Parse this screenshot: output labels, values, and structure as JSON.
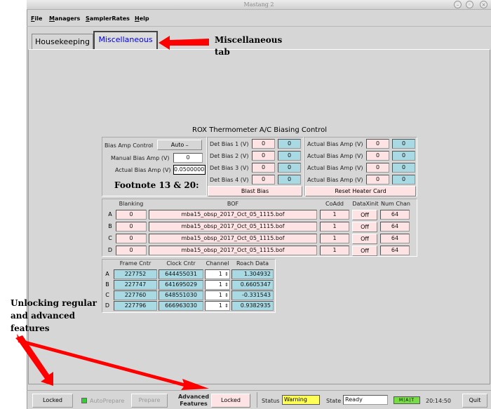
{
  "window": {
    "title": "Mastang 2"
  },
  "menu": {
    "items": [
      {
        "first": "F",
        "rest": "ile"
      },
      {
        "first": "M",
        "rest": "anagers"
      },
      {
        "first": "S",
        "rest": "amplerRates"
      },
      {
        "first": "H",
        "rest": "elp"
      }
    ]
  },
  "tabs": {
    "housekeeping": "Housekeeping",
    "miscellaneous": "Miscellaneous"
  },
  "annotations": {
    "misc_tab_line1": "Miscellaneous",
    "misc_tab_line2": "tab",
    "footnote": "Footnote 13 & 20:",
    "unlock_line1": "Unlocking  regular",
    "unlock_line2": "and advanced",
    "unlock_line3": "features"
  },
  "rox": {
    "title": "ROX Thermometer A/C Biasing Control",
    "bias_amp_control_label": "Bias Amp Control",
    "bias_amp_control_value": "Auto",
    "manual_bias_amp_label": "Manual Bias Amp (V)",
    "manual_bias_amp_value": "0",
    "actual_bias_amp_label": "Actual Bias Amp (V)",
    "actual_bias_amp_value": "0.0500000",
    "det_bias": [
      {
        "label": "Det Bias 1 (V)",
        "set": "0",
        "read": "0"
      },
      {
        "label": "Det Bias 2 (V)",
        "set": "0",
        "read": "0"
      },
      {
        "label": "Det Bias 3 (V)",
        "set": "0",
        "read": "0"
      },
      {
        "label": "Det Bias 4 (V)",
        "set": "0",
        "read": "0"
      }
    ],
    "actual_amp": [
      {
        "label": "Actual Bias Amp (V)",
        "set": "0",
        "read": "0"
      },
      {
        "label": "Actual Bias Amp (V)",
        "set": "0",
        "read": "0"
      },
      {
        "label": "Actual Bias Amp (V)",
        "set": "0",
        "read": "0"
      },
      {
        "label": "Actual Bias Amp (V)",
        "set": "0",
        "read": "0"
      }
    ],
    "blast_bias": "Blast Bias",
    "reset_heater": "Reset Heater Card"
  },
  "bof": {
    "headers": {
      "blanking": "Blanking",
      "bof": "BOF",
      "coadd": "CoAdd",
      "dataxinit": "DataXinit",
      "numchan": "Num Chan"
    },
    "rows": [
      {
        "label": "A",
        "blanking": "0",
        "bof": "mba15_obsp_2017_Oct_05_1115.bof",
        "coadd": "1",
        "dataxinit": "Off",
        "numchan": "64"
      },
      {
        "label": "B",
        "blanking": "0",
        "bof": "mba15_obsp_2017_Oct_05_1115.bof",
        "coadd": "1",
        "dataxinit": "Off",
        "numchan": "64"
      },
      {
        "label": "C",
        "blanking": "0",
        "bof": "mba15_obsp_2017_Oct_05_1115.bof",
        "coadd": "1",
        "dataxinit": "Off",
        "numchan": "64"
      },
      {
        "label": "D",
        "blanking": "0",
        "bof": "mba15_obsp_2017_Oct_05_1115.bof",
        "coadd": "1",
        "dataxinit": "Off",
        "numchan": "64"
      }
    ]
  },
  "roach": {
    "headers": {
      "frame": "Frame Cntr",
      "clock": "Clock Cntr",
      "channel": "Channel",
      "data": "Roach Data"
    },
    "rows": [
      {
        "label": "A",
        "frame": "227752",
        "clock": "644455031",
        "channel": "1",
        "data": "1.304932"
      },
      {
        "label": "B",
        "frame": "227747",
        "clock": "641695029",
        "channel": "1",
        "data": "0.6605347"
      },
      {
        "label": "C",
        "frame": "227760",
        "clock": "648551030",
        "channel": "1",
        "data": "-0.331543"
      },
      {
        "label": "D",
        "frame": "227796",
        "clock": "666963030",
        "channel": "1",
        "data": "0.9382935"
      }
    ]
  },
  "statusbar": {
    "locked": "Locked",
    "autoprepare": "AutoPrepare",
    "prepare": "Prepare",
    "advanced_line1": "Advanced",
    "advanced_line2": "Features",
    "advanced_locked": "Locked",
    "status_label": "Status",
    "status_value": "Warning",
    "state_label": "State",
    "state_value": "Ready",
    "indicators": [
      "M",
      "A",
      "T"
    ],
    "time": "20:14:50",
    "quit": "Quit"
  },
  "colors": {
    "pink": "#fde3e3",
    "cyan": "#a9d9e3",
    "warning": "#ffff55",
    "arrow": "#ff0000",
    "tab_active_text": "#0000dd"
  }
}
